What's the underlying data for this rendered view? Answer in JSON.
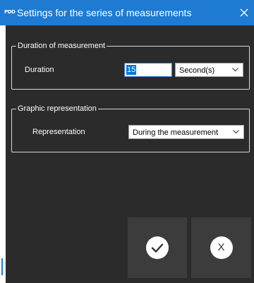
{
  "window": {
    "title": "Settings for the series of measurements",
    "icon_text": "PDD",
    "accent_color": "#1e7bd1"
  },
  "duration_group": {
    "legend": "Duration of measurement",
    "label": "Duration",
    "value": "15",
    "unit_selected": "Second(s)"
  },
  "graphic_group": {
    "legend": "Graphic representation",
    "label": "Representation",
    "selected": "During the measurement"
  },
  "buttons": {
    "ok_icon": "checkmark-icon",
    "cancel_icon": "x-icon",
    "cancel_glyph": "X"
  }
}
